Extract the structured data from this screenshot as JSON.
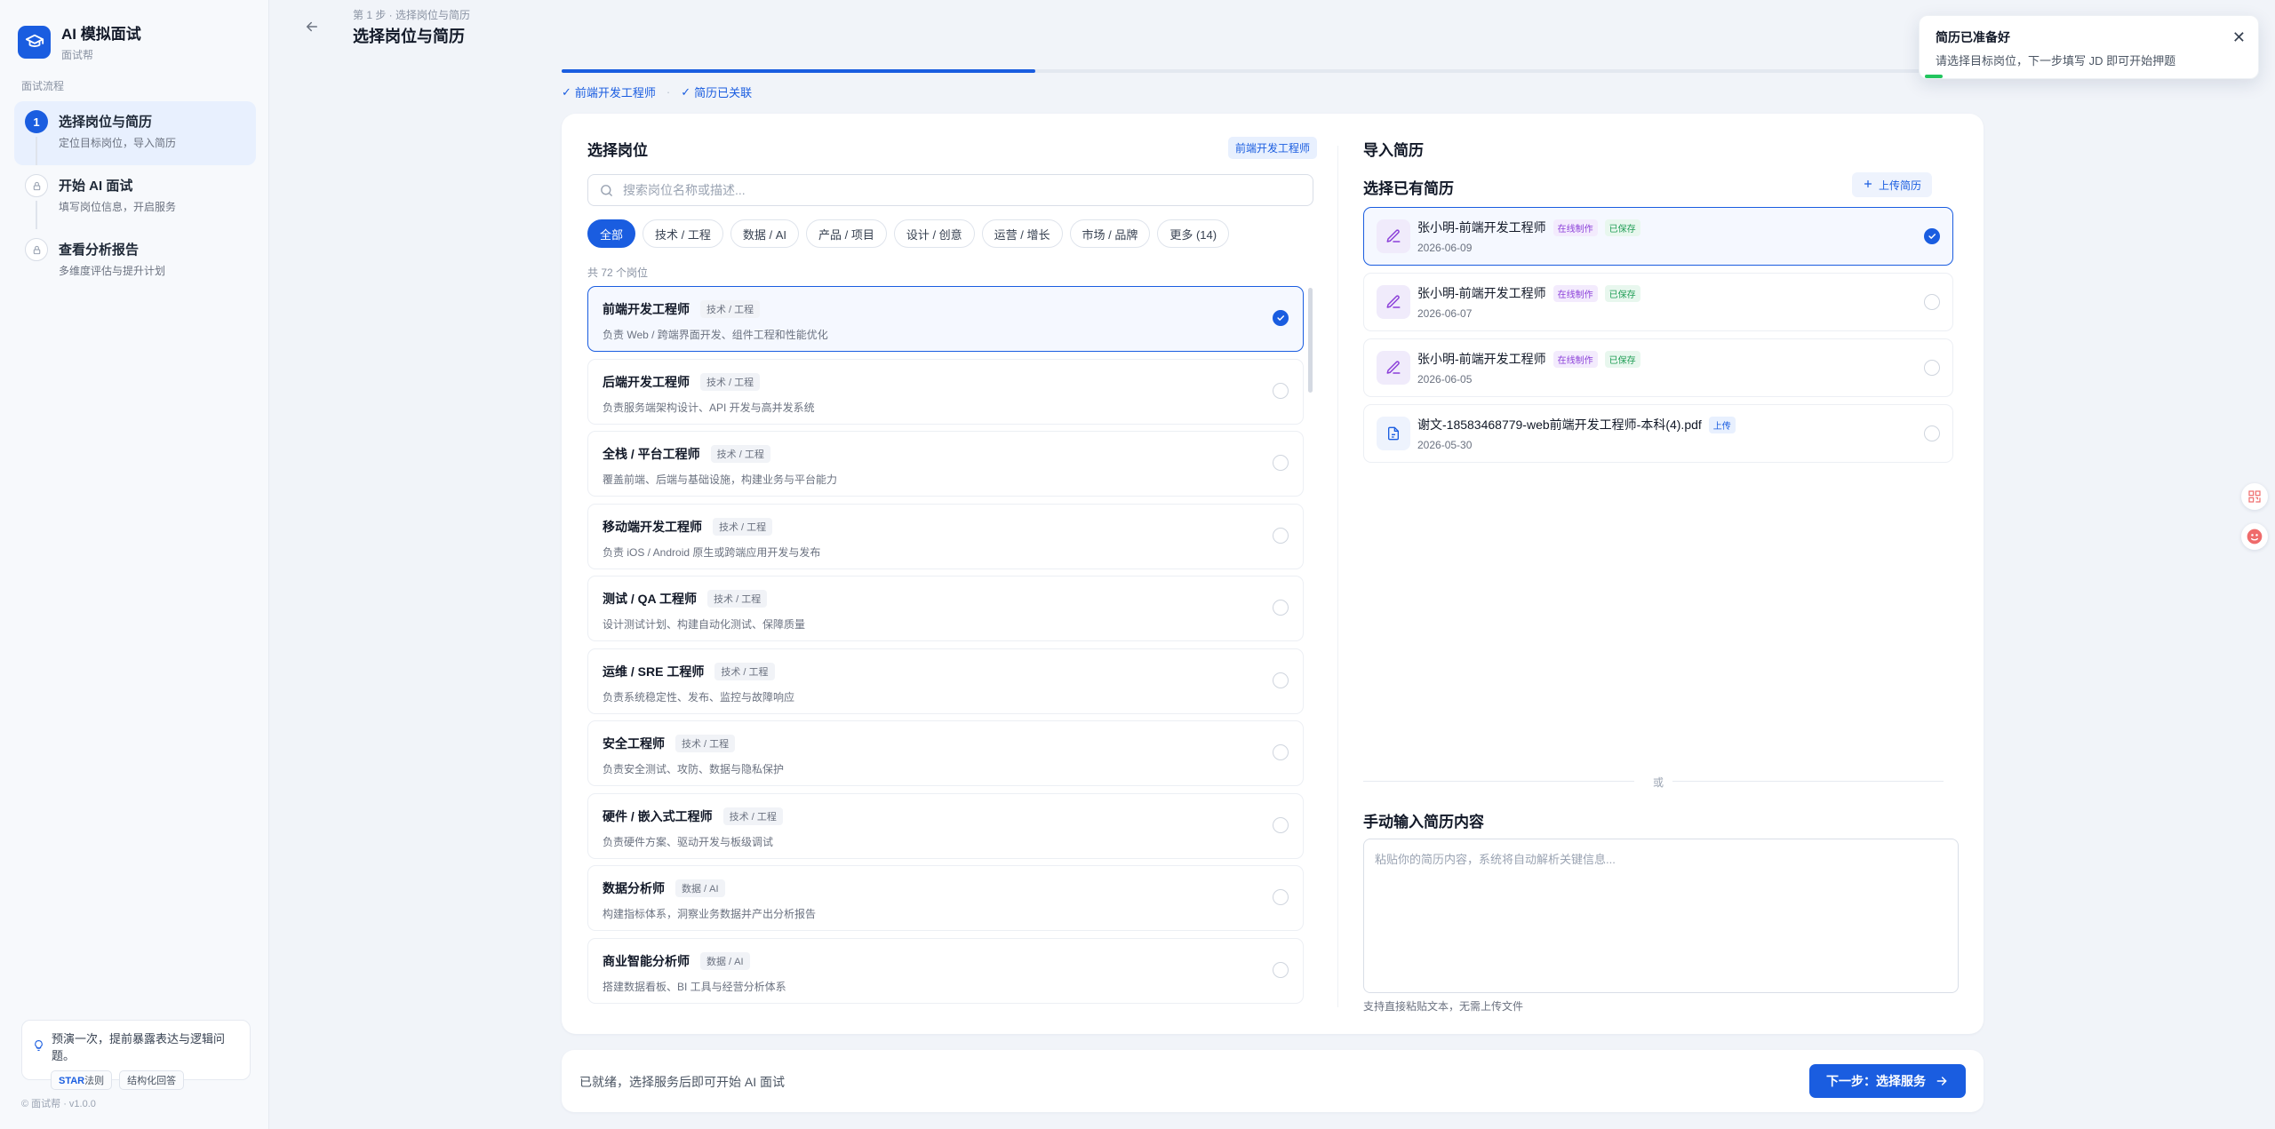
{
  "brand": {
    "title": "AI 模拟面试",
    "subtitle": "面试帮"
  },
  "sidebar": {
    "flow_label": "面试流程",
    "steps": [
      {
        "number": "1",
        "title": "选择岗位与简历",
        "desc": "定位目标岗位，导入简历"
      },
      {
        "number": "",
        "title": "开始 AI 面试",
        "desc": "填写岗位信息，开启服务"
      },
      {
        "number": "",
        "title": "查看分析报告",
        "desc": "多维度评估与提升计划"
      }
    ],
    "tip": {
      "text": "预演一次，提前暴露表达与逻辑问题。",
      "tag1_strong": "STAR",
      "tag1_rest": "法则",
      "tag2": "结构化回答"
    },
    "version": "© 面试帮 · v1.0.0"
  },
  "header": {
    "breadcrumb": "第 1 步 · 选择岗位与简历",
    "title": "选择岗位与简历"
  },
  "progress": {
    "percent": 33.3,
    "crumb1": "前端开发工程师",
    "separator": "·",
    "crumb2": "简历已关联"
  },
  "left_panel": {
    "title": "选择岗位",
    "selected_badge": "前端开发工程师",
    "search_placeholder": "搜索岗位名称或描述...",
    "filters": [
      "全部",
      "技术 / 工程",
      "数据 / AI",
      "产品 / 项目",
      "设计 / 创意",
      "运营 / 增长",
      "市场 / 品牌",
      "更多 (14)"
    ],
    "count": "共 72 个岗位",
    "roles": [
      {
        "name": "前端开发工程师",
        "tag": "技术 / 工程",
        "desc": "负责 Web / 跨端界面开发、组件工程和性能优化",
        "selected": true
      },
      {
        "name": "后端开发工程师",
        "tag": "技术 / 工程",
        "desc": "负责服务端架构设计、API 开发与高并发系统",
        "selected": false
      },
      {
        "name": "全栈 / 平台工程师",
        "tag": "技术 / 工程",
        "desc": "覆盖前端、后端与基础设施，构建业务与平台能力",
        "selected": false
      },
      {
        "name": "移动端开发工程师",
        "tag": "技术 / 工程",
        "desc": "负责 iOS / Android 原生或跨端应用开发与发布",
        "selected": false
      },
      {
        "name": "测试 / QA 工程师",
        "tag": "技术 / 工程",
        "desc": "设计测试计划、构建自动化测试、保障质量",
        "selected": false
      },
      {
        "name": "运维 / SRE 工程师",
        "tag": "技术 / 工程",
        "desc": "负责系统稳定性、发布、监控与故障响应",
        "selected": false
      },
      {
        "name": "安全工程师",
        "tag": "技术 / 工程",
        "desc": "负责安全测试、攻防、数据与隐私保护",
        "selected": false
      },
      {
        "name": "硬件 / 嵌入式工程师",
        "tag": "技术 / 工程",
        "desc": "负责硬件方案、驱动开发与板级调试",
        "selected": false
      },
      {
        "name": "数据分析师",
        "tag": "数据 / AI",
        "desc": "构建指标体系，洞察业务数据并产出分析报告",
        "selected": false
      },
      {
        "name": "商业智能分析师",
        "tag": "数据 / AI",
        "desc": "搭建数据看板、BI 工具与经营分析体系",
        "selected": false
      }
    ]
  },
  "right_panel": {
    "title": "导入简历",
    "subtitle": "选择已有简历",
    "upload_label": "上传简历",
    "resumes": [
      {
        "name": "张小明-前端开发工程师",
        "tags": [
          "在线制作",
          "已保存"
        ],
        "date": "2026-06-09",
        "selected": true,
        "icon": "edit-icon"
      },
      {
        "name": "张小明-前端开发工程师",
        "tags": [
          "在线制作",
          "已保存"
        ],
        "date": "2026-06-07",
        "selected": false,
        "icon": "edit-icon"
      },
      {
        "name": "张小明-前端开发工程师",
        "tags": [
          "在线制作",
          "已保存"
        ],
        "date": "2026-06-05",
        "selected": false,
        "icon": "edit-icon"
      },
      {
        "name": "谢文-18583468779-web前端开发工程师-本科(4).pdf",
        "tags": [
          "上传"
        ],
        "date": "2026-05-30",
        "selected": false,
        "icon": "file-icon"
      }
    ],
    "or_text": "或",
    "manual_title": "手动输入简历内容",
    "manual_placeholder": "粘贴你的简历内容，系统将自动解析关键信息...",
    "manual_value": "",
    "manual_hint": "支持直接粘贴文本，无需上传文件"
  },
  "footer": {
    "status": "已就绪，选择服务后即可开始 AI 面试",
    "next_label": "下一步：选择服务"
  },
  "toast": {
    "title": "简历已准备好",
    "message": "请选择目标岗位，下一步填写 JD 即可开始押题"
  },
  "colors": {
    "accent": "#1a5de0",
    "online_tag": "#8b3fd9",
    "saved_tag": "#1f9d55",
    "toast_edge": "#22c55e"
  }
}
